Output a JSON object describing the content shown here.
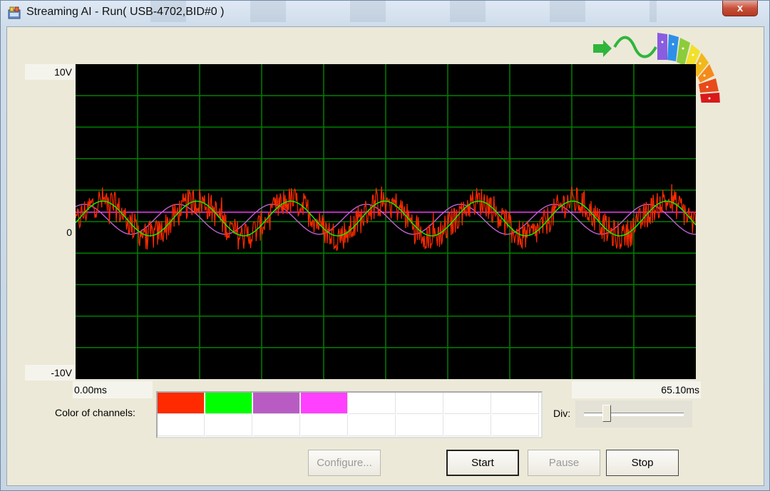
{
  "window": {
    "title": "Streaming AI - Run( USB-4702,BID#0 )",
    "close_label": "x"
  },
  "plot": {
    "y_max_label": "10V",
    "y_mid_label": "0",
    "y_min_label": "-10V",
    "x_start_label": "0.00ms",
    "x_end_label": "65.10ms",
    "background": "#000000",
    "grid_color": "#008000",
    "grid_on": true
  },
  "chart_data": {
    "type": "line",
    "x_range": [
      0,
      65.1
    ],
    "y_range": [
      -10,
      10
    ],
    "xlabel": "",
    "ylabel": "",
    "series": [
      {
        "color": "#ff2a00",
        "shape": "noisy-sine",
        "amplitude": 1.1,
        "cycles": 6.6,
        "offset": 0.2
      },
      {
        "color": "#00ff00",
        "shape": "sine",
        "amplitude": 1.1,
        "cycles": 6.6,
        "offset": 0.2
      },
      {
        "color": "#c060d0",
        "shape": "sine",
        "amplitude": 0.95,
        "cycles": 6.6,
        "offset": 0.15,
        "phase_shift": true
      },
      {
        "color": "#ff40ff",
        "shape": "flat",
        "value": 0.6
      }
    ]
  },
  "channels": {
    "label": "Color of channels:",
    "colors": [
      "#ff2a00",
      "#00ff00",
      "#b85cc4",
      "#ff40ff"
    ]
  },
  "div": {
    "label": "Div:",
    "value": 0.2
  },
  "buttons": {
    "configure": "Configure...",
    "start": "Start",
    "pause": "Pause",
    "stop": "Stop"
  }
}
